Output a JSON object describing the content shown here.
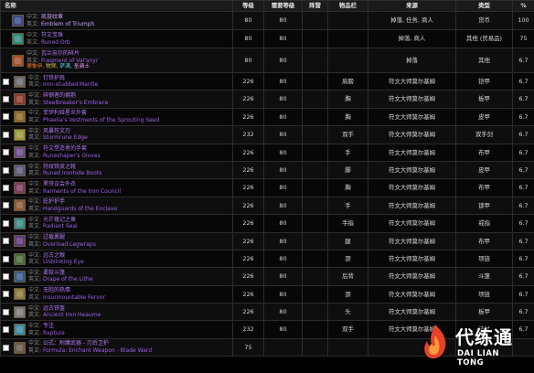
{
  "table": {
    "headers": {
      "name": "名称",
      "level": "等级",
      "req_level": "需要等级",
      "camp": "阵营",
      "slot": "物品栏",
      "source": "来源",
      "type": "类型",
      "pct": "%"
    },
    "label_cn": "中文:",
    "label_en": "英文:",
    "rows": [
      {
        "checkbox": false,
        "icon": "emblem-of-triumph-icon",
        "icon_color": "#3a4a8c",
        "cn": "凯旋纹章",
        "en": "Emblem of Triumph",
        "level": "80",
        "req": "80",
        "camp": "",
        "slot": "",
        "source": "掉落, 任务, 商人",
        "type": "货币",
        "pct": "100"
      },
      {
        "checkbox": false,
        "icon": "runed-orb-icon",
        "icon_color": "#2f8a7a",
        "cn": "符文宝珠",
        "en": "Runed Orb",
        "level": "80",
        "req": "80",
        "camp": "",
        "slot": "",
        "source": "掉落, 商人",
        "type": "其他 (贸易品)",
        "pct": "75"
      },
      {
        "checkbox": false,
        "icon": "fragment-of-valanyr-icon",
        "icon_color": "#a0522d",
        "cn": "瓦兰奈尔的碎片",
        "en": "Fragment of Val'anyr",
        "extra": [
          {
            "text": "德鲁伊",
            "cls": "a"
          },
          {
            "text": "牧师",
            "cls": "b"
          },
          {
            "text": "萨满",
            "cls": "d"
          },
          {
            "text": "圣骑士",
            "cls": "c2"
          }
        ],
        "level": "80",
        "req": "80",
        "camp": "",
        "slot": "",
        "source": "掉落",
        "type": "其他",
        "pct": "6.7"
      },
      {
        "checkbox": false,
        "icon": "iron-studded-mantle-icon",
        "icon_color": "#6b6b6b",
        "cn": "钉铁护肩",
        "en": "Iron-studded Mantle",
        "level": "226",
        "req": "80",
        "camp": "",
        "slot": "肩膀",
        "source": "符文大师莫尔基姆",
        "type": "铠甲",
        "pct": "6.7"
      },
      {
        "checkbox": false,
        "icon": "steelbreakers-embrace-icon",
        "icon_color": "#8a3b2a",
        "cn": "碎钢者的拥抱",
        "en": "Steelbreaker's Embrace",
        "level": "226",
        "req": "80",
        "camp": "",
        "slot": "胸",
        "source": "符文大师莫尔基姆",
        "type": "板甲",
        "pct": "6.7"
      },
      {
        "checkbox": false,
        "icon": "phaelias-vestments-icon",
        "icon_color": "#8a6a2a",
        "cn": "菲伊利娅星炎外套",
        "en": "Phaelia's Vestments of the Sprouting Seed",
        "level": "226",
        "req": "80",
        "camp": "",
        "slot": "胸",
        "source": "符文大师莫尔基姆",
        "type": "皮甲",
        "pct": "6.7"
      },
      {
        "checkbox": false,
        "icon": "stormrune-edge-icon",
        "icon_color": "#9a9a3a",
        "cn": "风暴符文刃",
        "en": "Stormrune Edge",
        "level": "232",
        "req": "80",
        "camp": "",
        "slot": "双手",
        "source": "符文大师莫尔基姆",
        "type": "双手剑",
        "pct": "6.7"
      },
      {
        "checkbox": false,
        "icon": "runeshapers-gloves-icon",
        "icon_color": "#6a4a8a",
        "cn": "符文塑造者的手套",
        "en": "Runeshaper's Gloves",
        "level": "226",
        "req": "80",
        "camp": "",
        "slot": "手",
        "source": "符文大师莫尔基姆",
        "type": "布甲",
        "pct": "6.7"
      },
      {
        "checkbox": false,
        "icon": "runed-ironhide-boots-icon",
        "icon_color": "#5a5a7a",
        "cn": "符纹铁皮之靴",
        "en": "Runed Ironhide Boots",
        "level": "226",
        "req": "80",
        "camp": "",
        "slot": "脚",
        "source": "符文大师莫尔基姆",
        "type": "皮甲",
        "pct": "6.7"
      },
      {
        "checkbox": false,
        "icon": "raiments-of-the-iron-council-icon",
        "icon_color": "#7a3a5a",
        "cn": "黑铁议会外衣",
        "en": "Raiments of the Iron Council",
        "level": "226",
        "req": "80",
        "camp": "",
        "slot": "胸",
        "source": "符文大师莫尔基姆",
        "type": "布甲",
        "pct": "6.7"
      },
      {
        "checkbox": false,
        "icon": "handguards-of-the-enclave-icon",
        "icon_color": "#8a5a3a",
        "cn": "庇护护手",
        "en": "Handguards of the Enclave",
        "level": "226",
        "req": "80",
        "camp": "",
        "slot": "手",
        "source": "符文大师莫尔基姆",
        "type": "锁甲",
        "pct": "6.7"
      },
      {
        "checkbox": false,
        "icon": "radiant-seal-icon",
        "icon_color": "#3a8a8a",
        "cn": "光芒蕴记之章",
        "en": "Radiant Seal",
        "level": "226",
        "req": "80",
        "camp": "",
        "slot": "手指",
        "source": "符文大师莫尔基姆",
        "type": "戒指",
        "pct": "6.7"
      },
      {
        "checkbox": false,
        "icon": "overload-legwraps-icon",
        "icon_color": "#5a3a7a",
        "cn": "过载裹腿",
        "en": "Overload Legwraps",
        "level": "226",
        "req": "80",
        "camp": "",
        "slot": "腿",
        "source": "符文大师莫尔基姆",
        "type": "布甲",
        "pct": "6.7"
      },
      {
        "checkbox": false,
        "icon": "unblinking-eye-icon",
        "icon_color": "#4a6a3a",
        "cn": "远古之眼",
        "en": "Unblinking Eye",
        "level": "226",
        "req": "80",
        "camp": "",
        "slot": "颈",
        "source": "符文大师莫尔基姆",
        "type": "项链",
        "pct": "6.7"
      },
      {
        "checkbox": false,
        "icon": "drape-of-the-lithe-icon",
        "icon_color": "#3a5a8a",
        "cn": "柔软斗篷",
        "en": "Drape of the Lithe",
        "level": "226",
        "req": "80",
        "camp": "",
        "slot": "后背",
        "source": "符文大师莫尔基姆",
        "type": "斗篷",
        "pct": "6.7"
      },
      {
        "checkbox": false,
        "icon": "insurmountable-fervor-icon",
        "icon_color": "#8a7a3a",
        "cn": "无阻的热情",
        "en": "Insurmountable Fervor",
        "level": "226",
        "req": "80",
        "camp": "",
        "slot": "颈",
        "source": "符文大师莫尔基姆",
        "type": "项链",
        "pct": "6.7"
      },
      {
        "checkbox": false,
        "icon": "ancient-iron-heaume-icon",
        "icon_color": "#7a7a7a",
        "cn": "远古铁盔",
        "en": "Ancient Iron Heaume",
        "level": "226",
        "req": "80",
        "camp": "",
        "slot": "头",
        "source": "符文大师莫尔基姆",
        "type": "板甲",
        "pct": "6.7"
      },
      {
        "checkbox": false,
        "icon": "rapture-icon",
        "icon_color": "#3a8aa0",
        "cn": "专注",
        "en": "Rapture",
        "level": "232",
        "req": "80",
        "camp": "",
        "slot": "双手",
        "source": "符文大师莫尔基姆",
        "type": "法杖",
        "pct": "6.7"
      },
      {
        "checkbox": false,
        "icon": "formula-enchant-weapon-icon",
        "icon_color": "#6a5a4a",
        "cn": "公式：附魔武器 - 刃后卫护",
        "en": "Formula: Enchant Weapon - Blade Ward",
        "level": "75",
        "req": "",
        "camp": "",
        "slot": "",
        "source": "",
        "type": "",
        "pct": ""
      }
    ]
  },
  "watermark": {
    "cn": "代练通",
    "en": "DAI LIAN TONG",
    "logo": "flame-logo"
  }
}
